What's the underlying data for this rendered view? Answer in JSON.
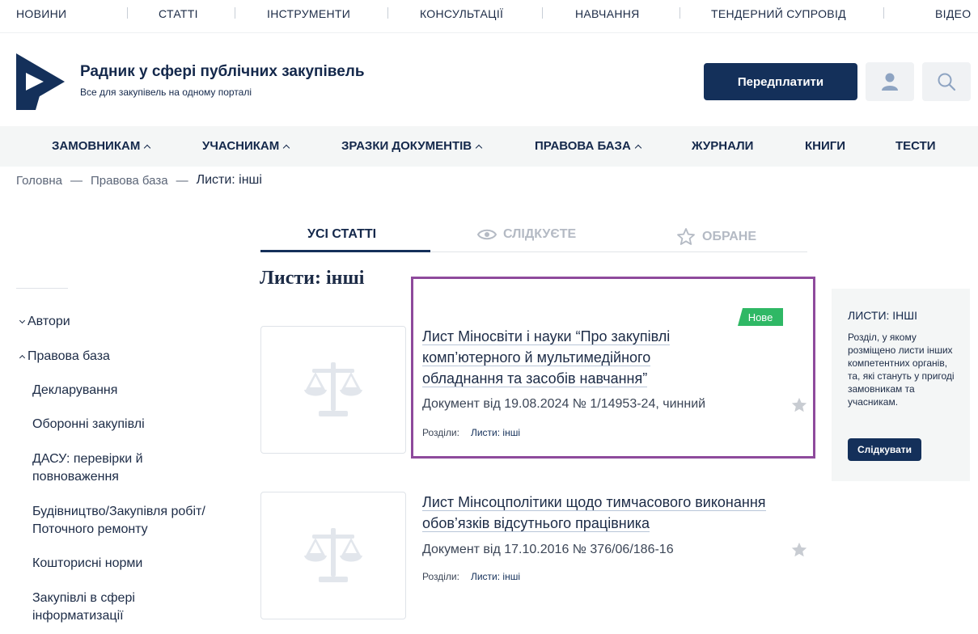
{
  "topnav": {
    "items": [
      "НОВИНИ",
      "СТАТТІ",
      "ІНСТРУМЕНТИ",
      "КОНСУЛЬТАЦІЇ",
      "НАВЧАННЯ",
      "ТЕНДЕРНИЙ СУПРОВІД",
      "ВІДЕО"
    ]
  },
  "header": {
    "title": "Радник у сфері публічних закупівель",
    "subtitle": "Все для закупівель на одному порталі",
    "subscribe_label": "Передплатити"
  },
  "mainmenu": {
    "items": [
      "ЗАМОВНИКАМ",
      "УЧАСНИКАМ",
      "ЗРАЗКИ ДОКУМЕНТІВ",
      "ПРАВОВА БАЗА",
      "ЖУРНАЛИ",
      "КНИГИ",
      "ТЕСТИ"
    ]
  },
  "breadcrumb": {
    "items": [
      "Головна",
      "Правова база"
    ],
    "separator": "—",
    "current": "Листи: інші"
  },
  "sidebar": {
    "authors": "Автори",
    "legal_base": "Правова база",
    "items": [
      "Декларування",
      "Оборонні закупівлі",
      "ДАСУ: перевірки й повноваження",
      "Будівництво/Закупівля робіт/ Поточного ремонту",
      "Кошторисні норми",
      "Закупівлі в сфері інформатизації"
    ]
  },
  "tabs": {
    "all": "УСІ СТАТТІ",
    "following": "СЛІДКУЄТЕ",
    "favorites": "ОБРАНЕ"
  },
  "section_title": "Листи: інші",
  "articles": [
    {
      "title": "Лист Міносвіти і науки “Про закупівлі комп’ютерного й мультимедійного обладнання та засобів навчання”",
      "badge": "Нове",
      "meta": "Документ від 19.08.2024 № 1/14953-24, чинний",
      "sections_label": "Розділи:",
      "section_link": "Листи: інші"
    },
    {
      "title": "Лист Мінсоцполітики щодо тимчасового виконання обов’язків відсутнього працівника",
      "meta": "Документ від 17.10.2016 № 376/06/186-16",
      "sections_label": "Розділи:",
      "section_link": "Листи: інші"
    }
  ],
  "infobox": {
    "title": "ЛИСТИ: ІНШІ",
    "text": "Розділ, у якому розміщено листи інших компетентних органів, та, які стануть у пригоді замовникам та учасникам.",
    "follow_label": "Слідкувати"
  },
  "colors": {
    "brand_navy": "#14305a",
    "badge_green": "#2fb865",
    "highlight_purple": "#8e4a9c"
  }
}
